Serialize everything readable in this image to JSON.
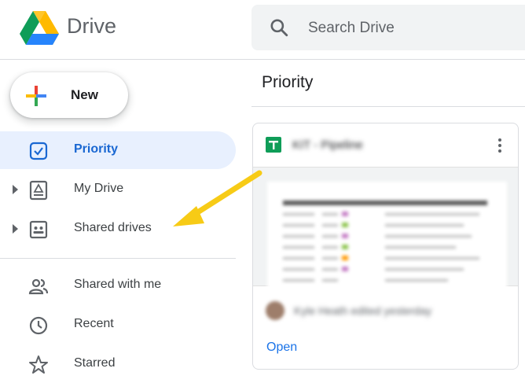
{
  "app": {
    "title": "Drive",
    "logo_icon": "drive-logo-icon"
  },
  "search": {
    "placeholder": "Search Drive",
    "icon": "search-icon"
  },
  "new_button": {
    "label": "New",
    "icon": "plus-icon"
  },
  "sidebar": {
    "items": [
      {
        "label": "Priority",
        "icon": "priority-check-icon",
        "active": true,
        "expandable": false
      },
      {
        "label": "My Drive",
        "icon": "my-drive-icon",
        "active": false,
        "expandable": true
      },
      {
        "label": "Shared drives",
        "icon": "shared-drives-icon",
        "active": false,
        "expandable": true
      },
      {
        "label": "Shared with me",
        "icon": "people-icon",
        "active": false,
        "expandable": false
      },
      {
        "label": "Recent",
        "icon": "clock-icon",
        "active": false,
        "expandable": false
      },
      {
        "label": "Starred",
        "icon": "star-icon",
        "active": false,
        "expandable": false
      }
    ]
  },
  "main": {
    "section_title": "Priority",
    "card": {
      "file_title": "KIT - Pipeline",
      "file_icon": "sheets-icon",
      "activity": "Kyle Heath edited yesterday",
      "action_label": "Open"
    }
  },
  "colors": {
    "accent": "#1967d2",
    "active_bg": "#e8f0fe",
    "arrow": "#f7cb16",
    "sheets_green": "#0f9d58"
  }
}
